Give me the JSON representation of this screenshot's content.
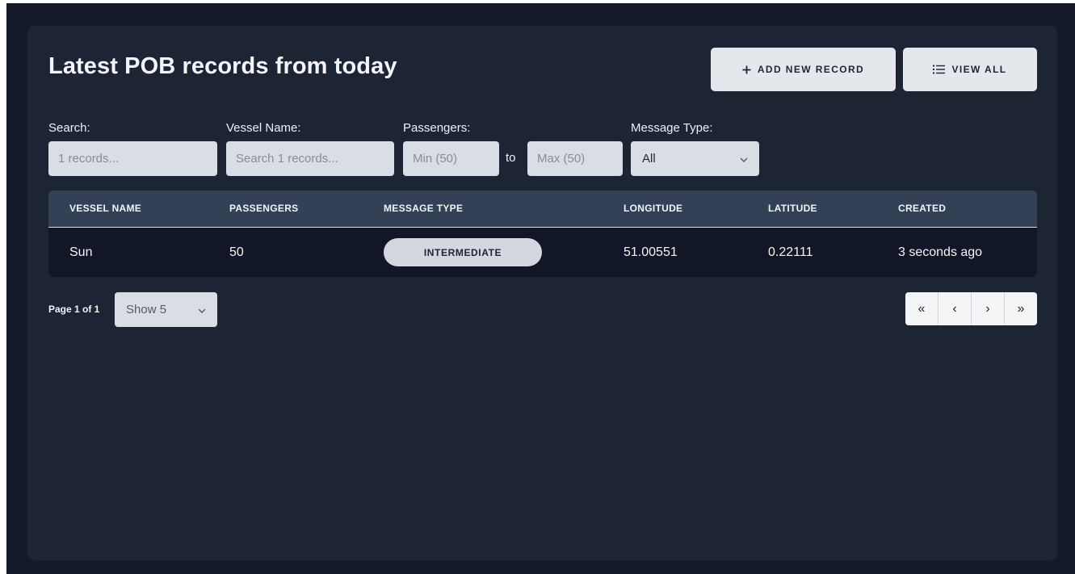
{
  "page": {
    "title": "Latest POB records from today"
  },
  "toolbar": {
    "add_label": "ADD NEW RECORD",
    "view_all_label": "VIEW ALL",
    "add_icon": "plus-icon",
    "view_icon": "list-icon"
  },
  "filters": {
    "search_label": "Search:",
    "search_placeholder": "1 records...",
    "vessel_label": "Vessel Name:",
    "vessel_placeholder": "Search 1 records...",
    "passengers_label": "Passengers:",
    "min_placeholder": "Min (50)",
    "to_text": "to",
    "max_placeholder": "Max (50)",
    "message_type_label": "Message Type:",
    "message_type_value": "All"
  },
  "table": {
    "headers": [
      "VESSEL NAME",
      "PASSENGERS",
      "MESSAGE TYPE",
      "LONGITUDE",
      "LATITUDE",
      "CREATED"
    ],
    "rows": [
      {
        "vessel_name": "Sun",
        "passengers": "50",
        "message_type": "INTERMEDIATE",
        "longitude": "51.00551",
        "latitude": "0.22111",
        "created": "3 seconds ago"
      }
    ]
  },
  "pagination": {
    "page_text": "Page 1 of 1",
    "page_size": "Show 5",
    "first": "«",
    "prev": "‹",
    "next": "›",
    "last": "»"
  },
  "colors": {
    "background": "#141a28",
    "panel": "#1d2535",
    "table_header": "#334056",
    "table_row": "#111726",
    "button": "#e4e7ec",
    "input": "#d9dde4"
  }
}
